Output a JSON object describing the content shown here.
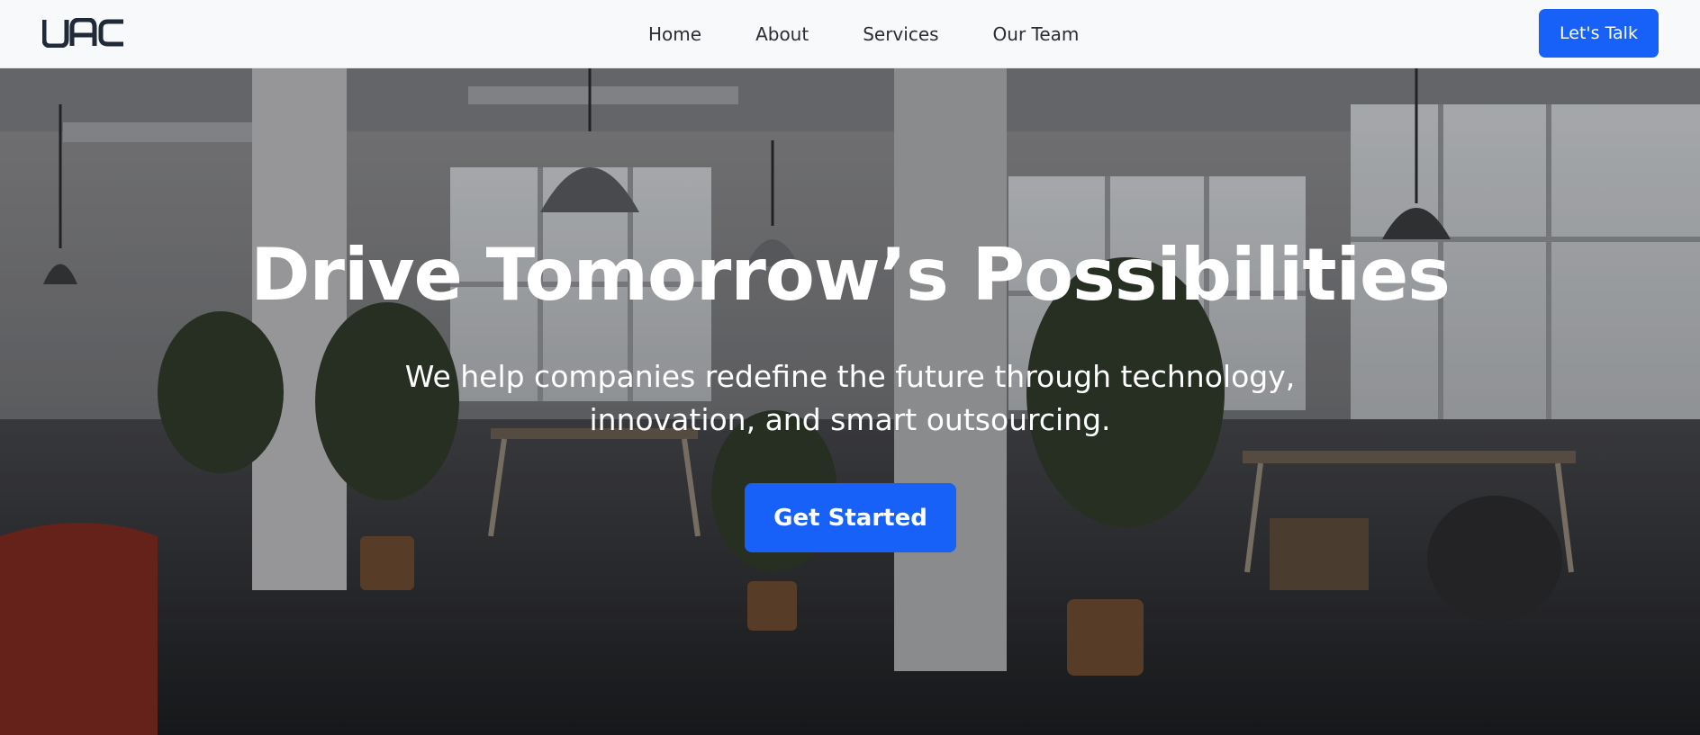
{
  "brand": {
    "name": "UAC"
  },
  "nav": {
    "items": [
      {
        "label": "Home"
      },
      {
        "label": "About"
      },
      {
        "label": "Services"
      },
      {
        "label": "Our Team"
      }
    ],
    "cta_label": "Let's Talk"
  },
  "hero": {
    "title": "Drive Tomorrow’s Possibilities",
    "subtitle_line1": "We help companies redefine the future through technology,",
    "subtitle_line2": "innovation, and smart outsourcing.",
    "button_label": "Get Started",
    "background_description_icon": "office-interior-photo"
  },
  "colors": {
    "accent": "#1761f9",
    "navbar_bg": "#f8f9fb",
    "logo": "#1f2937",
    "hero_text": "#ffffff"
  }
}
